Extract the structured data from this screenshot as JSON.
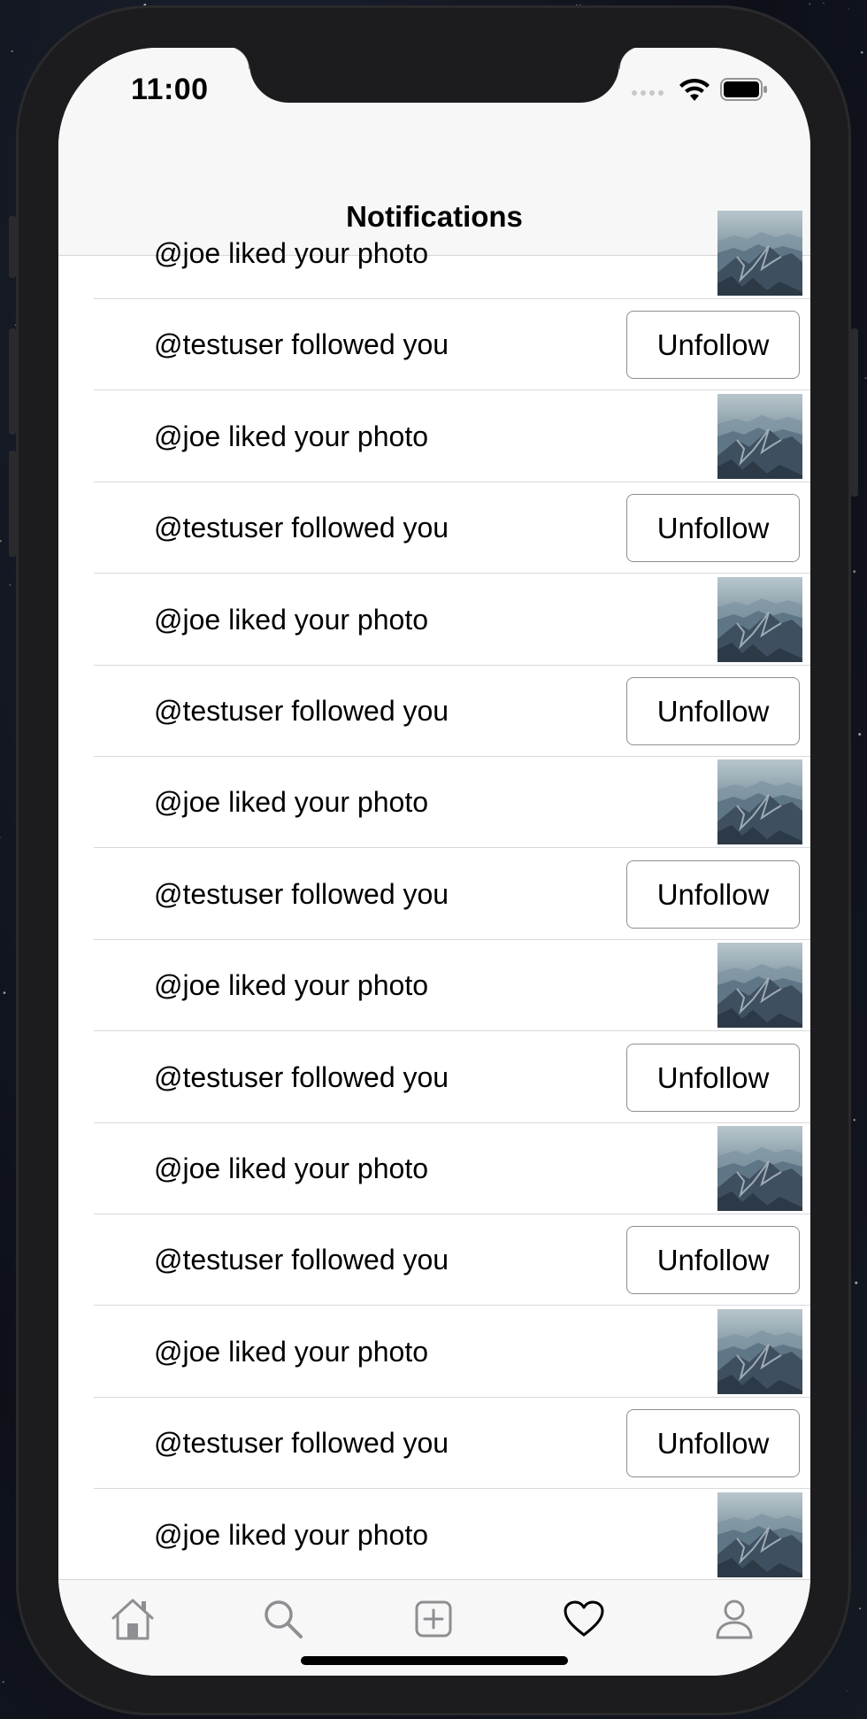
{
  "status_bar": {
    "time": "11:00"
  },
  "nav": {
    "title": "Notifications"
  },
  "notifications": [
    {
      "type": "like",
      "text": "@joe liked your photo"
    },
    {
      "type": "follow",
      "text": "@testuser followed you",
      "button": "Unfollow"
    },
    {
      "type": "like",
      "text": "@joe liked your photo"
    },
    {
      "type": "follow",
      "text": "@testuser followed you",
      "button": "Unfollow"
    },
    {
      "type": "like",
      "text": "@joe liked your photo"
    },
    {
      "type": "follow",
      "text": "@testuser followed you",
      "button": "Unfollow"
    },
    {
      "type": "like",
      "text": "@joe liked your photo"
    },
    {
      "type": "follow",
      "text": "@testuser followed you",
      "button": "Unfollow"
    },
    {
      "type": "like",
      "text": "@joe liked your photo"
    },
    {
      "type": "follow",
      "text": "@testuser followed you",
      "button": "Unfollow"
    },
    {
      "type": "like",
      "text": "@joe liked your photo"
    },
    {
      "type": "follow",
      "text": "@testuser followed you",
      "button": "Unfollow"
    },
    {
      "type": "like",
      "text": "@joe liked your photo"
    },
    {
      "type": "follow",
      "text": "@testuser followed you",
      "button": "Unfollow"
    },
    {
      "type": "like",
      "text": "@joe liked your photo"
    }
  ],
  "tabs": [
    {
      "icon": "home-icon"
    },
    {
      "icon": "search-icon"
    },
    {
      "icon": "add-post-icon"
    },
    {
      "icon": "heart-icon",
      "selected": true
    },
    {
      "icon": "profile-icon"
    }
  ],
  "colors": {
    "bar_background": "#f7f7f7",
    "separator": "#d8d8dc",
    "inactive_icon": "#8e8e93",
    "active_icon": "#000000"
  }
}
